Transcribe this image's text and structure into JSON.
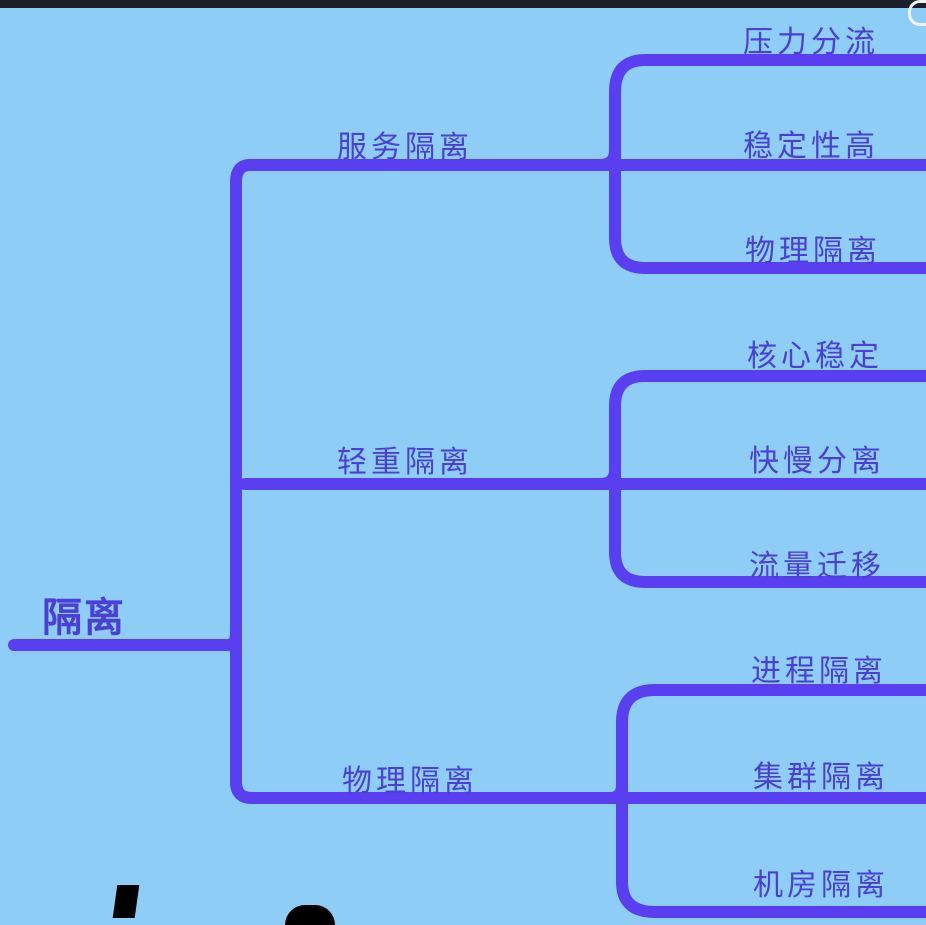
{
  "root": {
    "label": "隔离"
  },
  "branches": [
    {
      "label": "服务隔离",
      "children": [
        "压力分流",
        "稳定性高",
        "物理隔离"
      ]
    },
    {
      "label": "轻重隔离",
      "children": [
        "核心稳定",
        "快慢分离",
        "流量迁移"
      ]
    },
    {
      "label": "物理隔离",
      "children": [
        "进程隔离",
        "集群隔离",
        "机房隔离"
      ]
    }
  ],
  "colors": {
    "background": "#8ecdf5",
    "line": "#5a3ff0",
    "text": "#4b3fd6"
  }
}
